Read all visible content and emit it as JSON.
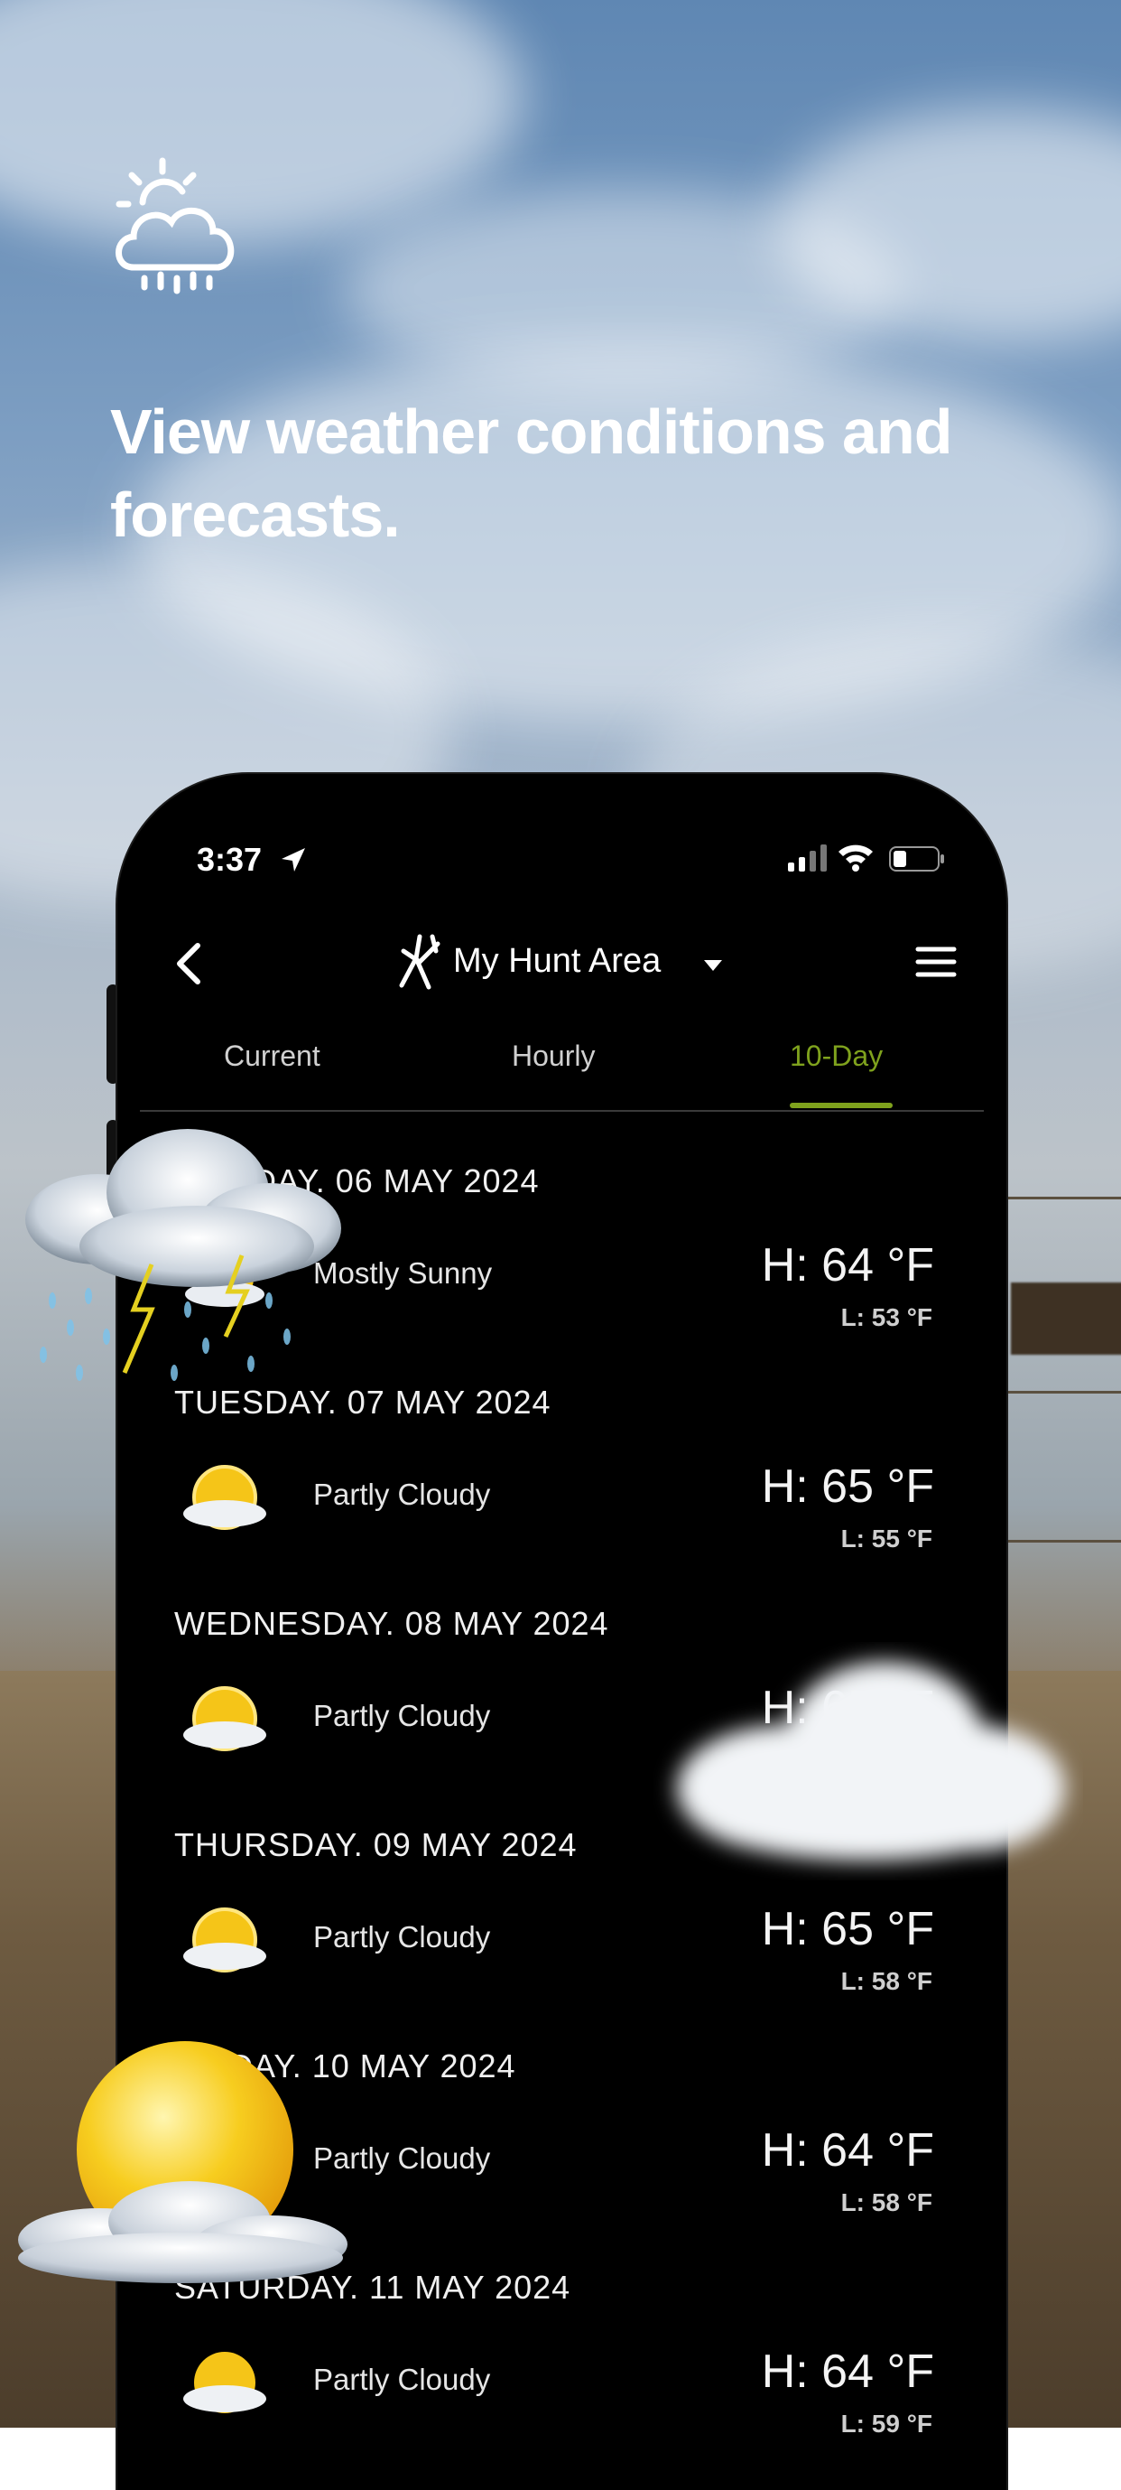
{
  "headline": "View weather conditions and forecasts.",
  "status_bar": {
    "time": "3:37"
  },
  "nav": {
    "title": "My Hunt Area",
    "back_icon": "chevron-left-icon",
    "menu_icon": "hamburger-menu-icon"
  },
  "tabs": [
    {
      "label": "Current",
      "active": false
    },
    {
      "label": "Hourly",
      "active": false
    },
    {
      "label": "10-Day",
      "active": true
    }
  ],
  "forecast": [
    {
      "date": "MONDAY. 06 MAY 2024",
      "condition": "Mostly Sunny",
      "high": "H: 64 °F",
      "low": "L: 53 °F"
    },
    {
      "date": "TUESDAY. 07 MAY 2024",
      "condition": "Partly Cloudy",
      "high": "H: 65 °F",
      "low": "L: 55 °F"
    },
    {
      "date": "WEDNESDAY. 08 MAY 2024",
      "condition": "Partly Cloudy",
      "high": "H: 65 °F",
      "low": ""
    },
    {
      "date": "THURSDAY. 09 MAY 2024",
      "condition": "Partly Cloudy",
      "high": "H: 65 °F",
      "low": "L: 58 °F"
    },
    {
      "date": "FRIDAY. 10 MAY 2024",
      "condition": "Partly Cloudy",
      "high": "H: 64 °F",
      "low": "L: 58 °F"
    },
    {
      "date": "SATURDAY. 11 MAY 2024",
      "condition": "Partly Cloudy",
      "high": "H: 64 °F",
      "low": "L: 59 °F"
    }
  ],
  "colors": {
    "accent": "#7fa21d",
    "phone_bg": "#000000"
  }
}
